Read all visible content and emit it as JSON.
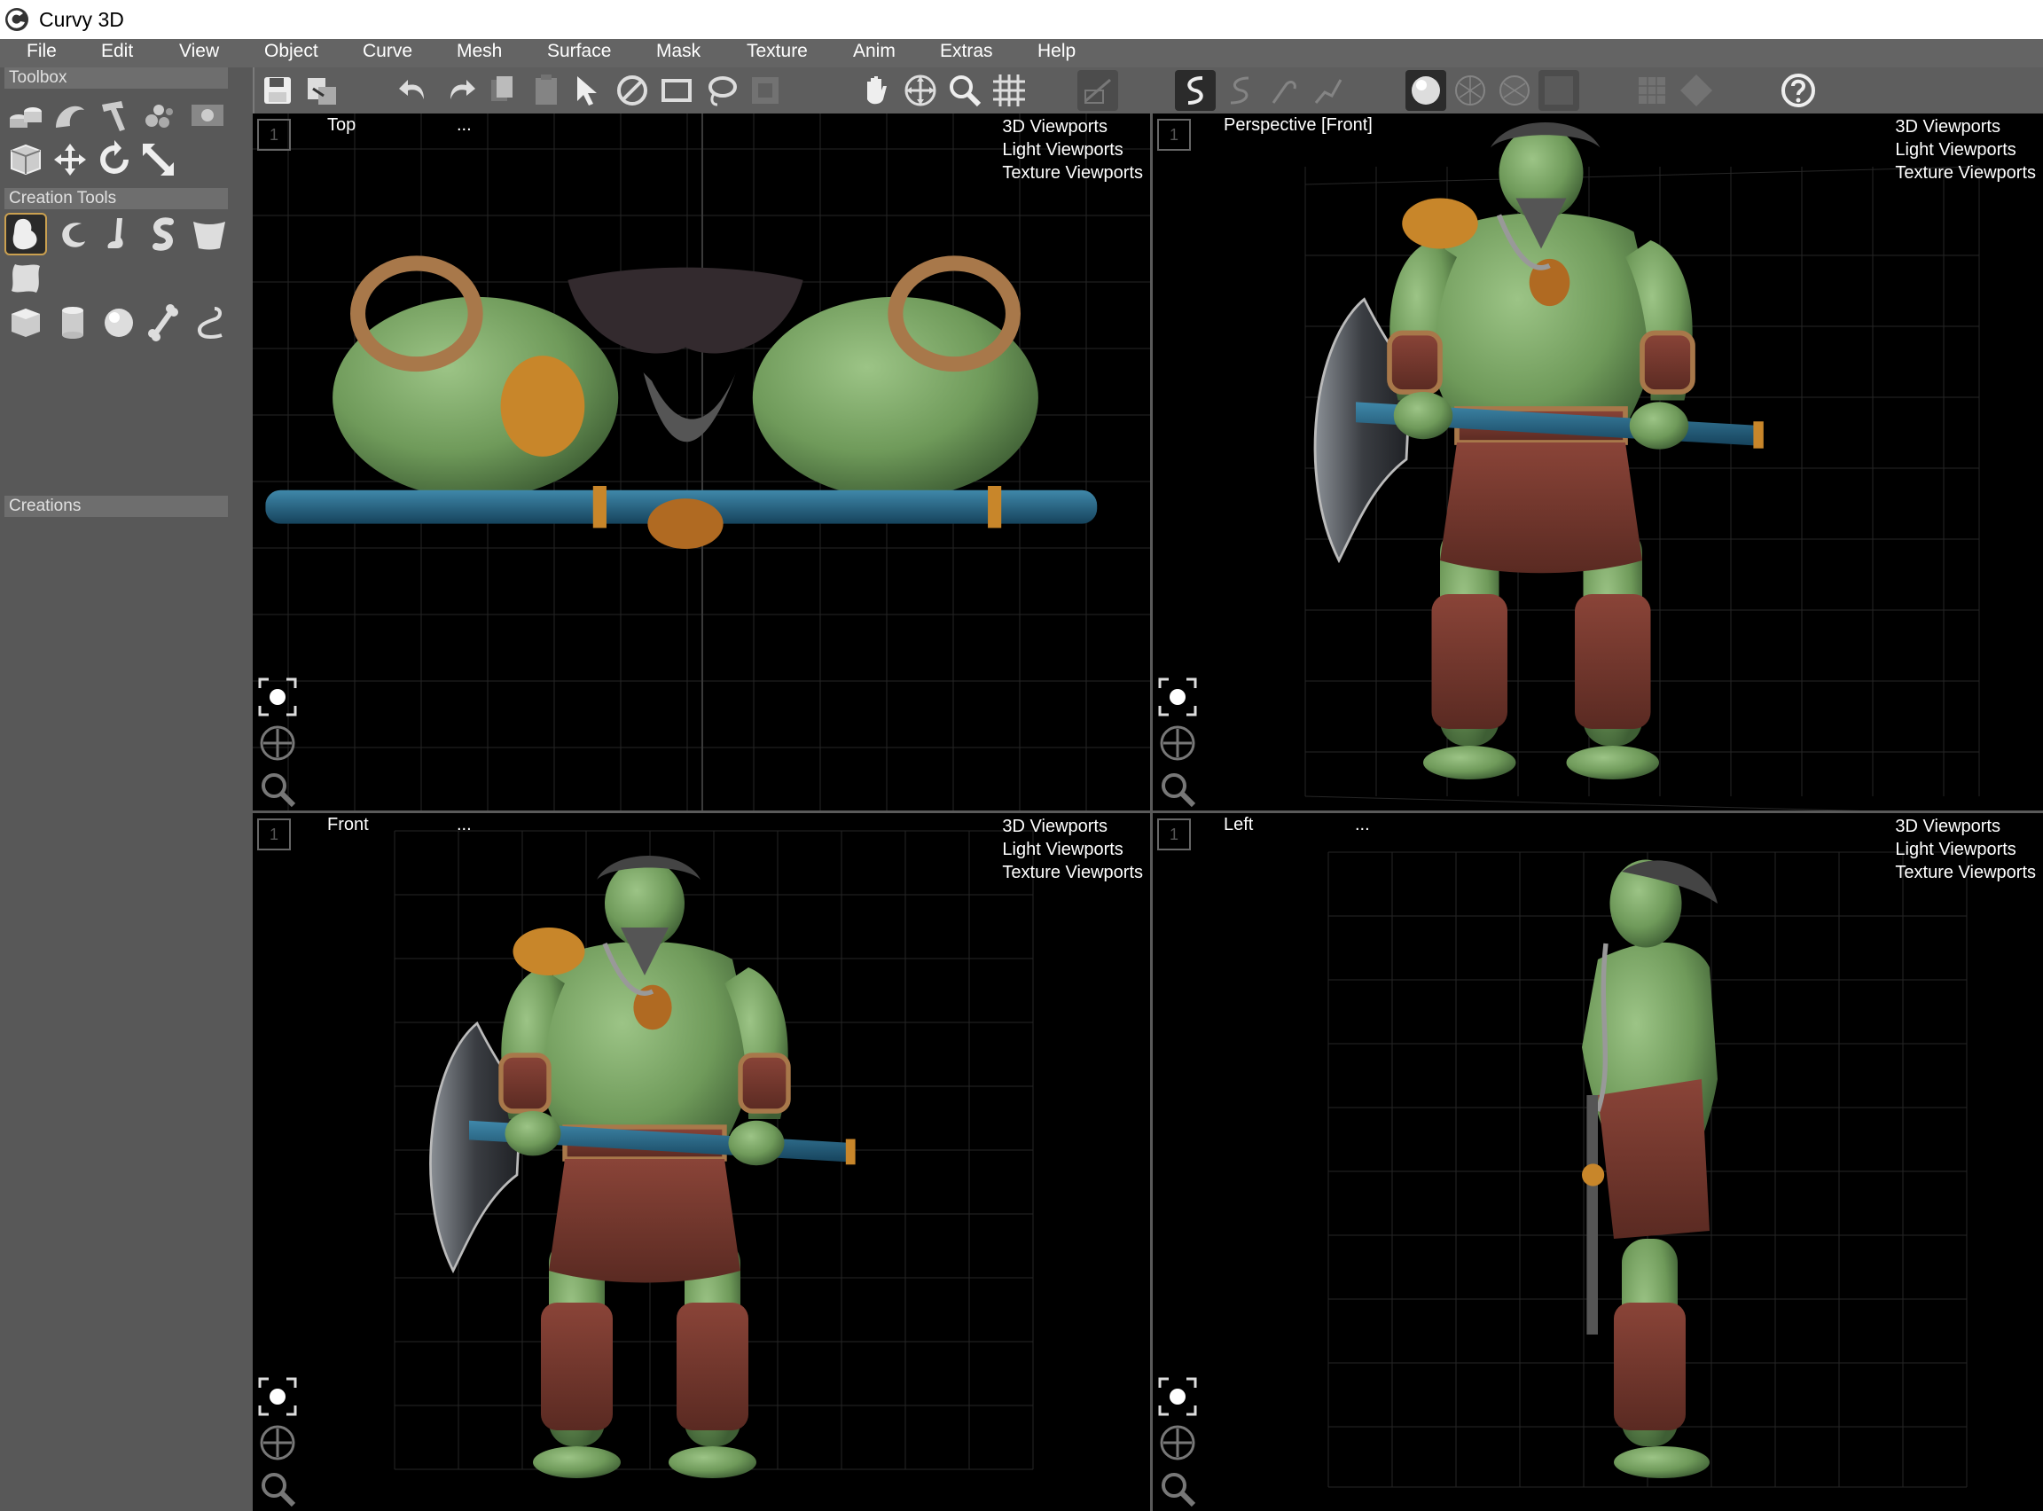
{
  "app": {
    "title": "Curvy 3D"
  },
  "menu": [
    "File",
    "Edit",
    "View",
    "Object",
    "Curve",
    "Mesh",
    "Surface",
    "Mask",
    "Texture",
    "Anim",
    "Extras",
    "Help"
  ],
  "sidebar": {
    "toolbox_label": "Toolbox",
    "creation_tools_label": "Creation Tools",
    "creations_label": "Creations"
  },
  "viewports": {
    "top_left": {
      "name": "Top",
      "more": "...",
      "menu": [
        "3D Viewports",
        "Light Viewports",
        "Texture Viewports"
      ],
      "number": "1"
    },
    "top_right": {
      "name": "Perspective [Front]",
      "more": "",
      "menu": [
        "3D Viewports",
        "Light Viewports",
        "Texture Viewports"
      ],
      "number": "1"
    },
    "bottom_left": {
      "name": "Front",
      "more": "...",
      "menu": [
        "3D Viewports",
        "Light Viewports",
        "Texture Viewports"
      ],
      "number": "1"
    },
    "bottom_right": {
      "name": "Left",
      "more": "...",
      "menu": [
        "3D Viewports",
        "Light Viewports",
        "Texture Viewports"
      ],
      "number": "1"
    }
  },
  "colors": {
    "skin": "#6f9a5a",
    "cloth": "#7a3a2e",
    "rope": "#a8784a",
    "handle": "#1f5a7a",
    "gold": "#c8862a"
  }
}
